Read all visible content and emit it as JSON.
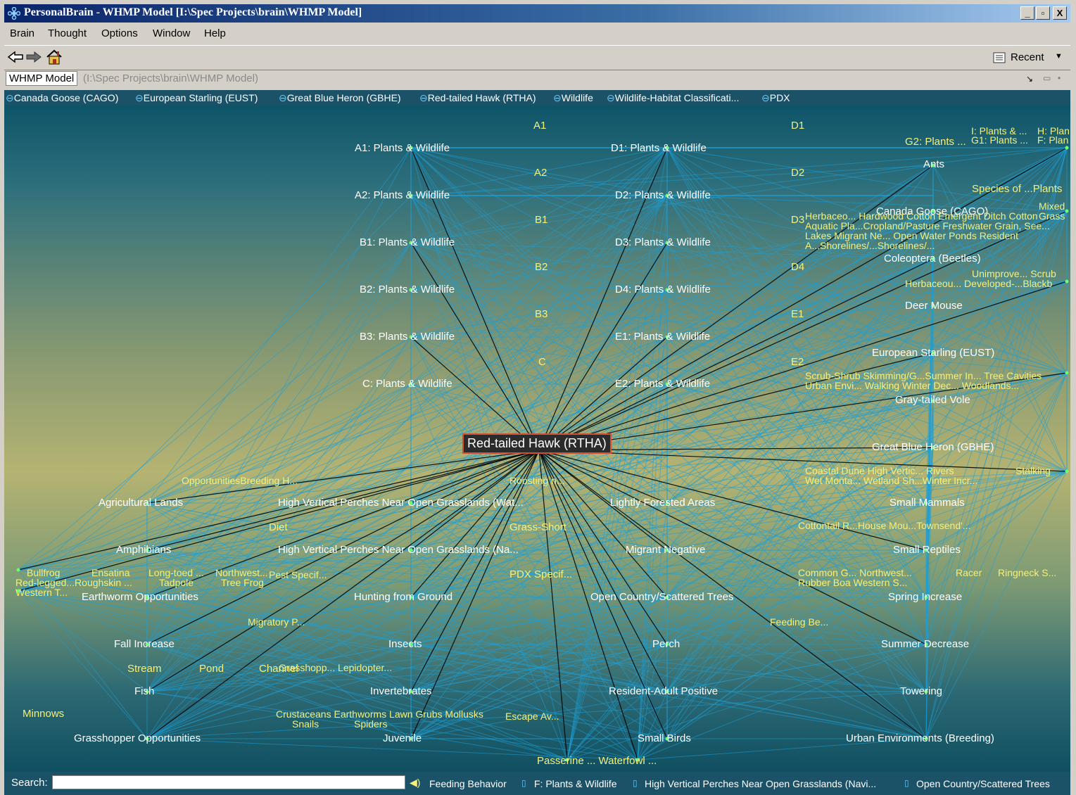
{
  "window": {
    "title": "PersonalBrain - WHMP Model [I:\\Spec Projects\\brain\\WHMP Model]",
    "minimize": "_",
    "maximize": "▫",
    "close": "X"
  },
  "menu": [
    "Brain",
    "Thought",
    "Options",
    "Window",
    "Help"
  ],
  "toolbar": {
    "recent_label": "Recent"
  },
  "crumb": {
    "name": "WHMP Model",
    "path": "(I:\\Spec Projects\\brain\\WHMP Model)"
  },
  "pins": [
    "Canada Goose (CAGO)",
    "European Starling (EUST)",
    "Great Blue Heron (GBHE)",
    "Red-tailed Hawk (RTHA)",
    "Wildlife",
    "Wildlife-Habitat Classificati...",
    "PDX"
  ],
  "active_thought": "Red-tailed Hawk (RTHA)",
  "thoughts": {
    "a1_head": "A1",
    "a1": "A1: Plants & Wildlife",
    "a2_head": "A2",
    "a2": "A2: Plants & Wildlife",
    "b1_head": "B1",
    "b1": "B1: Plants & Wildlife",
    "b2_head": "B2",
    "b2": "B2: Plants & Wildlife",
    "b3_head": "B3",
    "b3": "B3: Plants & Wildlife",
    "c_head": "C",
    "c": "C: Plants & Wildlife",
    "d1_head": "D1",
    "d1": "D1: Plants & Wildlife",
    "d2_head": "D2",
    "d2": "D2: Plants & Wildlife",
    "d3_head": "D3",
    "d3": "D3: Plants & Wildlife",
    "d4_head": "D4",
    "d4": "D4: Plants & Wildlife",
    "e1_head": "E1",
    "e1": "E1: Plants & Wildlife",
    "e2_head": "E2",
    "e2": "E2: Plants & Wildlife",
    "g2": "G2: Plants ...",
    "ig": "I: Plants & ...  G1: Plants ...",
    "hf": "H: Plan  F: Plan",
    "ants": "Ants",
    "species": "Species of ...Plants",
    "cago": "Canada Goose (CAGO)",
    "mixed": "Mixed  Grass",
    "cluster1": "Herbaceo... Hardwood  Cotton  Emergent      Ditch  Cotton  Aquatic Pla...Cropland/Pasture  Freshwater  Grain, See...  Lakes  Migrant Ne...  Open Water  Ponds  Resident A...Shorelines/...Shorelines/...",
    "coleoptera": "Coleoptera (Beetles)",
    "unimprove": "Unimprove... Scrub",
    "herbaceou": "Herbaceou... Developed-...Blackb",
    "deer_mouse": "Deer Mouse",
    "eust": "European Starling (EUST)",
    "scrub": "Scrub-Shrub Skimming/G...Summer In... Tree Cavities",
    "urban_env": "Urban Envi...  Walking    Winter Dec... Woodlands...",
    "gray_vole": "Gray-tailed Vole",
    "gbhe": "Great Blue Heron (GBHE)",
    "coastal": "Coastal Dune High Vertic... Rivers",
    "stalking": "Stalking",
    "wetmonta": "Wet Monta...  Wetland Sh...Winter Incr...",
    "small_mammals": "Small Mammals",
    "cottontail": "Cottontail R...House Mou...Townsend'...",
    "small_reptiles": "Small Reptiles",
    "common_g": "Common G...  Northwest...",
    "racer": "Racer",
    "ringneck": "Ringneck S...",
    "rubber": "Rubber Boa  Western S...",
    "spring": "Spring Increase",
    "feeding_be": "Feeding Be...",
    "summer": "Summer Decrease",
    "towering": "Towering",
    "urban_breed": "Urban Environments (Breeding)",
    "opps": "OpportunitiesBreeding H...",
    "roosting": "Roosting n...",
    "ag_lands": "Agricultural Lands",
    "hvp1": "High Vertical Perches Near Open Grasslands (Wat...",
    "lightly": "Lightly Forested Areas",
    "diet": "Diet",
    "grass_short": "Grass-Short",
    "amphibians": "Amphibians",
    "hvp2": "High Vertical Perches Near Open Grasslands (Na...",
    "migrant_neg": "Migrant Negative",
    "bullfrog": "Bullfrog",
    "ensatina": "Ensatina",
    "longtoed": "Long-toed ...",
    "northwest": "Northwest...",
    "pest": "Pest Specif...",
    "redlegged": "Red-legged...Roughskin ...",
    "tadpole": "Tadpole",
    "treefrog": "Tree Frog",
    "western_t": "Western T...",
    "pdx_specif": "PDX Specif...",
    "earthworm": "Earthworm  Opportunities",
    "hunting": "Hunting from Ground",
    "open_country": "Open Country/Scattered Trees",
    "migratory": "Migratory P...",
    "fall": "Fall Increase",
    "insects": "Insects",
    "perch": "Perch",
    "stream": "Stream",
    "pond": "Pond",
    "channel": "Channel",
    "grasshopp": "Grasshopp... Lepidopter...",
    "fish": "Fish",
    "invertebrates": "Invertebrates",
    "resident_adult": "Resident-Adult Positive",
    "minnows": "Minnows",
    "crustaceans": "Crustaceans Earthworms  Lawn Grubs   Mollusks",
    "escape": "Escape Av...",
    "snails": "Snails",
    "spiders": "Spiders",
    "grasshopper_opp": "Grasshopper Opportunities",
    "juvenile": "Juvenile",
    "small_birds": "Small Birds",
    "passerine": "Passerine ... Waterfowl ..."
  },
  "status": {
    "search_label": "Search:",
    "search_value": "",
    "crumbs": [
      "Feeding Behavior",
      "F: Plants & Wildlife",
      "High Vertical Perches Near Open Grasslands (Navi...",
      "Open Country/Scattered Trees"
    ]
  },
  "colors": {
    "link_line": "#1e9fd6",
    "child_line": "#000000",
    "node_text": "#ffffff",
    "child_text": "#f5f07a"
  }
}
